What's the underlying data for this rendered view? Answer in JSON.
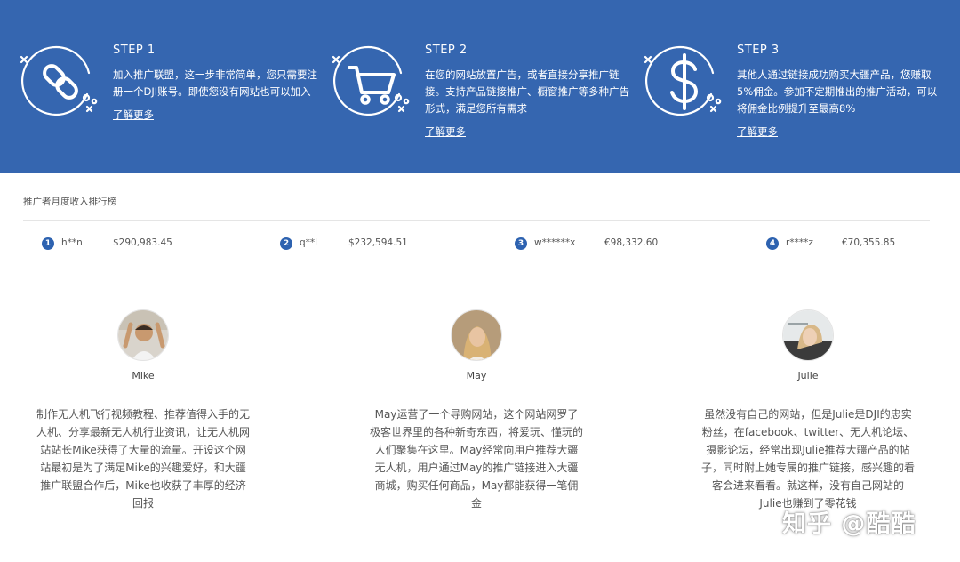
{
  "colors": {
    "banner_bg": "#3566b0",
    "rank_badge": "#2d62b0"
  },
  "steps": [
    {
      "icon": "chain-link-icon",
      "title": "STEP 1",
      "description": "加入推广联盟，这一步非常简单，您只需要注册一个DJI账号。即使您没有网站也可以加入",
      "link": "了解更多"
    },
    {
      "icon": "shopping-cart-icon",
      "title": "STEP 2",
      "description": "在您的网站放置广告，或者直接分享推广链接。支持产品链接推广、橱窗推广等多种广告形式，满足您所有需求",
      "link": "了解更多"
    },
    {
      "icon": "dollar-sign-icon",
      "title": "STEP 3",
      "description": "其他人通过链接成功购买大疆产品，您赚取5%佣金。参加不定期推出的推广活动，可以将佣金比例提升至最高8%",
      "link": "了解更多"
    }
  ],
  "ranking": {
    "title": "推广者月度收入排行榜",
    "items": [
      {
        "rank": "1",
        "user": "h**n",
        "amount": "$290,983.45"
      },
      {
        "rank": "2",
        "user": "q**l",
        "amount": "$232,594.51"
      },
      {
        "rank": "3",
        "user": "w******x",
        "amount": "€98,332.60"
      },
      {
        "rank": "4",
        "user": "r****z",
        "amount": "€70,355.85"
      }
    ]
  },
  "testimonials": [
    {
      "name": "Mike",
      "text": "制作无人机飞行视频教程、推荐值得入手的无人机、分享最新无人机行业资讯，让无人机网站站长Mike获得了大量的流量。开设这个网站最初是为了满足Mike的兴趣爱好，和大疆推广联盟合作后，Mike也收获了丰厚的经济回报"
    },
    {
      "name": "May",
      "text": "May运营了一个导购网站，这个网站网罗了极客世界里的各种新奇东西，将爱玩、懂玩的人们聚集在这里。May经常向用户推荐大疆无人机，用户通过May的推广链接进入大疆商城，购买任何商品，May都能获得一笔佣金"
    },
    {
      "name": "Julie",
      "text": "虽然没有自己的网站，但是Julie是DJI的忠实粉丝，在facebook、twitter、无人机论坛、摄影论坛，经常出现Julie推荐大疆产品的帖子，同时附上她专属的推广链接，感兴趣的看客会进来看看。就这样，没有自己网站的Julie也赚到了零花钱"
    }
  ],
  "watermark": "知乎 @酷酷"
}
